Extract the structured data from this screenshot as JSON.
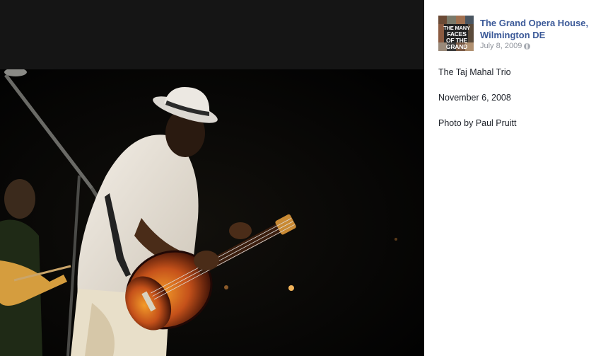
{
  "photo": {
    "alt": "Musician in white hat playing sunburst acoustic guitar on stage"
  },
  "post": {
    "page_name": "The Grand Opera House, Wilmington DE",
    "date": "July 8, 2009",
    "avatar_text": [
      "THE MANY",
      "FACES",
      "OF THE",
      "GRAND"
    ],
    "caption_lines": [
      "The Taj Mahal Trio",
      "November 6, 2008",
      "Photo by Paul Pruitt"
    ]
  },
  "icons": {
    "privacy": "globe-icon"
  }
}
